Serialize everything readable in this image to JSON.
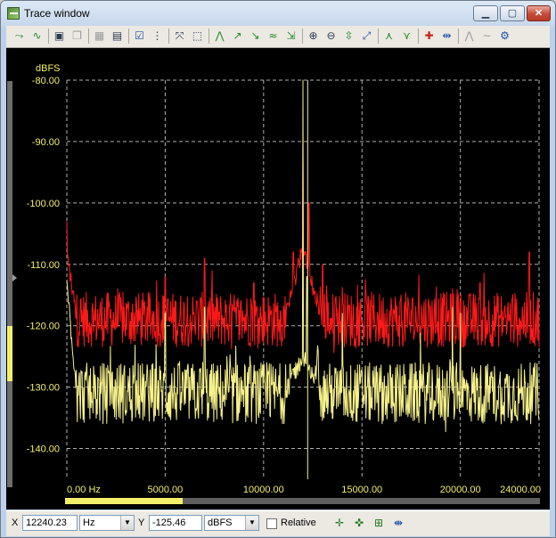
{
  "window": {
    "title": "Trace window"
  },
  "toolbar": {
    "buttons": [
      {
        "name": "add-trace-icon",
        "glyph": "⤳",
        "tone": "green"
      },
      {
        "name": "trace-wave-icon",
        "glyph": "∿",
        "tone": "green"
      },
      {
        "name": "save-icon",
        "glyph": "▣",
        "tone": "dark"
      },
      {
        "name": "copy-icon",
        "glyph": "❐",
        "tone": "gray"
      },
      {
        "name": "print-preview-icon",
        "glyph": "▦",
        "tone": "gray"
      },
      {
        "name": "export-image-icon",
        "glyph": "▤",
        "tone": "dark"
      },
      {
        "name": "properties-icon",
        "glyph": "☑",
        "tone": "blue"
      },
      {
        "name": "data-table-icon",
        "glyph": "⋮",
        "tone": "dark"
      },
      {
        "name": "zoom-fit-icon",
        "glyph": "⤧",
        "tone": "dark"
      },
      {
        "name": "zoom-region-icon",
        "glyph": "⬚",
        "tone": "dark"
      },
      {
        "name": "peak-icon",
        "glyph": "⋀",
        "tone": "green"
      },
      {
        "name": "trace-up-icon",
        "glyph": "↗",
        "tone": "green"
      },
      {
        "name": "trace-down-icon",
        "glyph": "↘",
        "tone": "green"
      },
      {
        "name": "trace-wave2-icon",
        "glyph": "≈",
        "tone": "green"
      },
      {
        "name": "trace-select-icon",
        "glyph": "⇲",
        "tone": "green"
      },
      {
        "name": "zoom-in-icon",
        "glyph": "⊕",
        "tone": "dark"
      },
      {
        "name": "zoom-out-icon",
        "glyph": "⊖",
        "tone": "dark"
      },
      {
        "name": "fit-y-icon",
        "glyph": "⇳",
        "tone": "green"
      },
      {
        "name": "auto-scale-icon",
        "glyph": "⤢",
        "tone": "blue"
      },
      {
        "name": "marker-up-icon",
        "glyph": "⋏",
        "tone": "green"
      },
      {
        "name": "marker-down-icon",
        "glyph": "⋎",
        "tone": "green"
      },
      {
        "name": "red-cursor-icon",
        "glyph": "✚",
        "tone": "red"
      },
      {
        "name": "swap-cursor-icon",
        "glyph": "⇹",
        "tone": "blue"
      },
      {
        "name": "disabled-a-icon",
        "glyph": "⋀",
        "tone": "gray"
      },
      {
        "name": "disabled-b-icon",
        "glyph": "∼",
        "tone": "gray"
      },
      {
        "name": "config-icon",
        "glyph": "⚙",
        "tone": "blue"
      }
    ]
  },
  "chart_data": {
    "type": "line",
    "ylabel": "dBFS",
    "ylim": [
      -145,
      -80
    ],
    "xlim": [
      0,
      24000
    ],
    "yticks": [
      "-80.00",
      "-90.00",
      "-100.00",
      "-110.00",
      "-120.00",
      "-130.00",
      "-140.00"
    ],
    "ytick_values": [
      -80,
      -90,
      -100,
      -110,
      -120,
      -130,
      -140
    ],
    "xticks": [
      "0.00 Hz",
      "5000.00",
      "10000.00",
      "15000.00",
      "20000.00",
      "24000.00"
    ],
    "xtick_values": [
      0,
      5000,
      10000,
      15000,
      20000,
      24000
    ],
    "grid": true,
    "cursor_x": 12240,
    "colors": {
      "red_series": "#ff1a1a",
      "yellow_series": "#f5f08a",
      "grid": "#b0b0b0",
      "axis_text": "#f3ef6a"
    },
    "series": [
      {
        "color": "#ff1a1a",
        "baseline": -119,
        "noise": 4.5,
        "low_freq_start": -108,
        "peaks": [
          [
            0,
            -103
          ],
          [
            5000,
            -112
          ],
          [
            7000,
            -109
          ],
          [
            9500,
            -113
          ],
          [
            12000,
            -91
          ],
          [
            12300,
            -100
          ],
          [
            11500,
            -108
          ],
          [
            13000,
            -110
          ],
          [
            21000,
            -113
          ],
          [
            23500,
            -108
          ]
        ]
      },
      {
        "color": "#f5f08a",
        "baseline": -131,
        "noise": 5,
        "low_freq_start": -113,
        "peaks": [
          [
            0,
            -117
          ],
          [
            5000,
            -118
          ],
          [
            7000,
            -117
          ],
          [
            12000,
            -80
          ],
          [
            12200,
            -112
          ],
          [
            14000,
            -118
          ],
          [
            19600,
            -117
          ],
          [
            20000,
            -118
          ]
        ]
      }
    ]
  },
  "status": {
    "x_label": "X",
    "x_value": "12240.23",
    "x_unit": "Hz",
    "y_label": "Y",
    "y_value": "-125.46",
    "y_unit": "dBFS",
    "relative_label": "Relative"
  }
}
